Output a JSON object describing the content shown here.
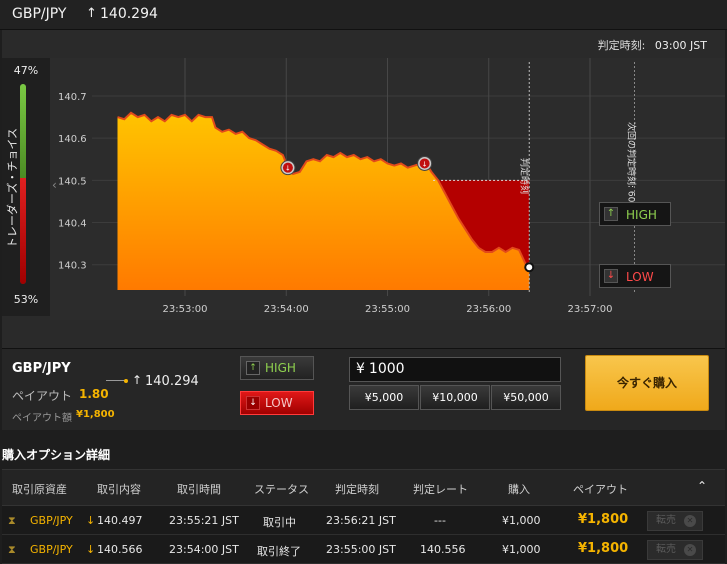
{
  "header": {
    "pair": "GBP/JPY",
    "arrow": "↑",
    "price": "140.294"
  },
  "chart": {
    "judge_label": "判定時刻:",
    "judge_time": "03:00 JST",
    "sentiment_high": "47%",
    "sentiment_low": "53%",
    "sentiment_high_fraction": 0.47,
    "sentiment_label": "トレーダーズ・チョイス",
    "vertical_judge_label": "判定時刻",
    "vertical_next_label": "次回の判定時刻: 60 秒",
    "high_label": "HIGH",
    "low_label": "LOW",
    "collapse_glyph": "‹",
    "colors": {
      "fill_top": "#ffc400",
      "fill_bottom": "#ff7a00",
      "losing": "#b40000",
      "line": "#e24a1a"
    }
  },
  "chart_data": {
    "type": "area",
    "y_ticks": [
      "140.7",
      "140.6",
      "140.5",
      "140.4",
      "140.3"
    ],
    "x_ticks": [
      "23:53:00",
      "23:54:00",
      "23:55:00",
      "23:56:00",
      "23:57:00"
    ],
    "ylim": [
      140.24,
      140.79
    ],
    "xlim_seconds": [
      -80,
      320
    ],
    "x_tick_seconds": [
      0,
      60,
      120,
      180,
      240
    ],
    "series": [
      {
        "points": [
          [
            -40,
            140.65
          ],
          [
            -36,
            140.645
          ],
          [
            -32,
            140.66
          ],
          [
            -28,
            140.65
          ],
          [
            -24,
            140.655
          ],
          [
            -20,
            140.64
          ],
          [
            -16,
            140.65
          ],
          [
            -12,
            140.64
          ],
          [
            -8,
            140.655
          ],
          [
            -4,
            140.65
          ],
          [
            0,
            140.655
          ],
          [
            4,
            140.64
          ],
          [
            8,
            140.655
          ],
          [
            12,
            140.65
          ],
          [
            16,
            140.65
          ],
          [
            18,
            140.625
          ],
          [
            22,
            140.615
          ],
          [
            26,
            140.62
          ],
          [
            30,
            140.61
          ],
          [
            34,
            140.615
          ],
          [
            38,
            140.6
          ],
          [
            42,
            140.595
          ],
          [
            46,
            140.585
          ],
          [
            50,
            140.575
          ],
          [
            54,
            140.57
          ],
          [
            58,
            140.56
          ],
          [
            61,
            140.53
          ],
          [
            64,
            140.515
          ],
          [
            68,
            140.52
          ],
          [
            72,
            140.545
          ],
          [
            76,
            140.55
          ],
          [
            80,
            140.545
          ],
          [
            84,
            140.56
          ],
          [
            88,
            140.555
          ],
          [
            92,
            140.565
          ],
          [
            96,
            140.555
          ],
          [
            100,
            140.56
          ],
          [
            104,
            140.55
          ],
          [
            108,
            140.555
          ],
          [
            112,
            140.545
          ],
          [
            116,
            140.55
          ],
          [
            120,
            140.54
          ],
          [
            124,
            140.535
          ],
          [
            128,
            140.54
          ],
          [
            132,
            140.53
          ],
          [
            136,
            140.535
          ],
          [
            140,
            140.54
          ],
          [
            143,
            140.54
          ],
          [
            146,
            140.52
          ],
          [
            150,
            140.5
          ],
          [
            154,
            140.47
          ],
          [
            158,
            140.44
          ],
          [
            162,
            140.41
          ],
          [
            166,
            140.385
          ],
          [
            170,
            140.36
          ],
          [
            174,
            140.34
          ],
          [
            178,
            140.33
          ],
          [
            182,
            140.33
          ],
          [
            186,
            140.34
          ],
          [
            190,
            140.33
          ],
          [
            194,
            140.34
          ],
          [
            198,
            140.335
          ],
          [
            202,
            140.3
          ],
          [
            204,
            140.294
          ]
        ]
      }
    ],
    "markers": [
      {
        "t": 61,
        "value": 140.53,
        "direction": "low"
      },
      {
        "t": 142,
        "value": 140.54,
        "direction": "low"
      }
    ],
    "strike_level": 140.5,
    "strike_start": 147,
    "current": {
      "t": 204,
      "value": 140.294
    },
    "expiry_seconds": 204
  },
  "trade": {
    "pair": "GBP/JPY",
    "payout_label": "ペイアウト",
    "payout_value": "1.80",
    "payamt_label": "ペイアウト額",
    "payamt_value": "¥1,800",
    "arrow": "↑",
    "price": "140.294",
    "high_label": "HIGH",
    "low_label": "LOW",
    "amount_symbol": "¥",
    "amount_value": "1000",
    "presets": [
      "¥5,000",
      "¥10,000",
      "¥50,000"
    ],
    "buy_label": "今すぐ購入"
  },
  "details": {
    "title": "購入オプション詳細",
    "headers": [
      "取引原資産",
      "取引内容",
      "取引時間",
      "ステータス",
      "判定時刻",
      "判定レート",
      "購入",
      "ペイアウト"
    ],
    "collapse_glyph": "⌃",
    "rows": [
      {
        "asset": "GBP/JPY",
        "arrow": "↓",
        "rate": "140.497",
        "time": "23:55:21 JST",
        "status": "取引中",
        "judge": "23:56:21 JST",
        "judge_rate": "---",
        "purchase": "¥1,000",
        "payout": "¥1,800",
        "sell": "転売"
      },
      {
        "asset": "GBP/JPY",
        "arrow": "↓",
        "rate": "140.566",
        "time": "23:54:00 JST",
        "status": "取引終了",
        "judge": "23:55:00 JST",
        "judge_rate": "140.556",
        "purchase": "¥1,000",
        "payout": "¥1,800",
        "sell": "転売"
      }
    ]
  }
}
